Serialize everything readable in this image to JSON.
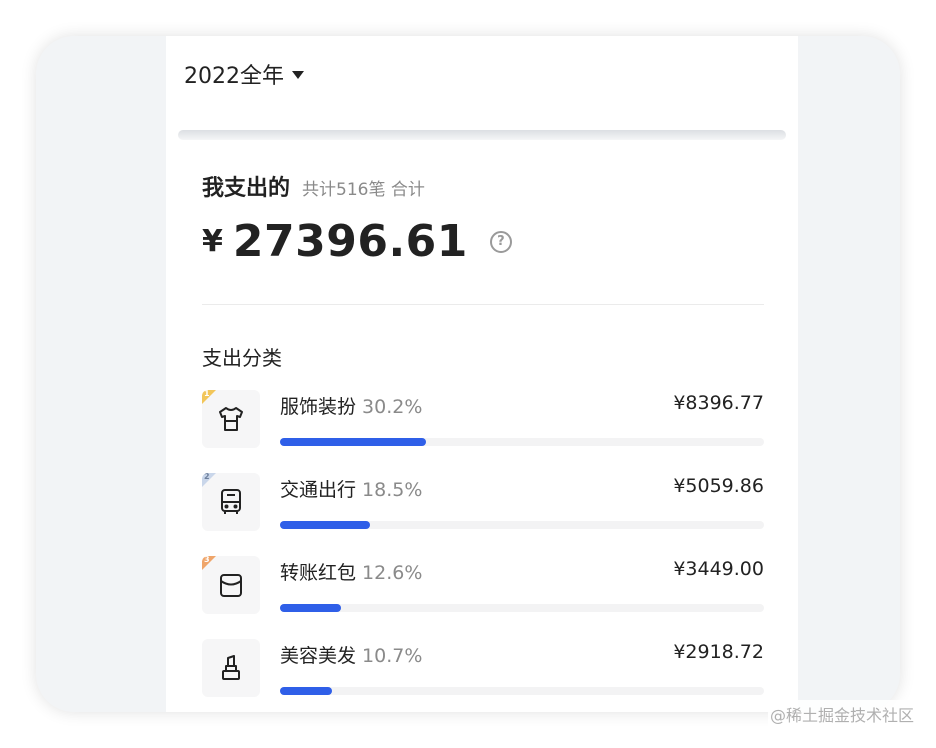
{
  "header": {
    "year_selector": "2022全年"
  },
  "summary": {
    "title": "我支出的",
    "subtitle": "共计516笔 合计",
    "currency": "¥",
    "total": "27396.61"
  },
  "categories": {
    "section_title": "支出分类",
    "items": [
      {
        "rank": "1",
        "name": "服饰装扮",
        "percent": "30.2%",
        "fraction": 0.302,
        "amount": "¥8396.77",
        "icon": "tshirt-icon",
        "badge_color": "#f2c65a"
      },
      {
        "rank": "2",
        "name": "交通出行",
        "percent": "18.5%",
        "fraction": 0.185,
        "amount": "¥5059.86",
        "icon": "bus-icon",
        "badge_color": "#c9d6ea"
      },
      {
        "rank": "3",
        "name": "转账红包",
        "percent": "12.6%",
        "fraction": 0.126,
        "amount": "¥3449.00",
        "icon": "red-envelope-icon",
        "badge_color": "#efa56a"
      },
      {
        "rank": "",
        "name": "美容美发",
        "percent": "10.7%",
        "fraction": 0.107,
        "amount": "¥2918.72",
        "icon": "lipstick-icon",
        "badge_color": ""
      }
    ]
  },
  "colors": {
    "accent": "#2f5fe8",
    "track": "#f3f3f4"
  },
  "watermark": "@稀土掘金技术社区"
}
